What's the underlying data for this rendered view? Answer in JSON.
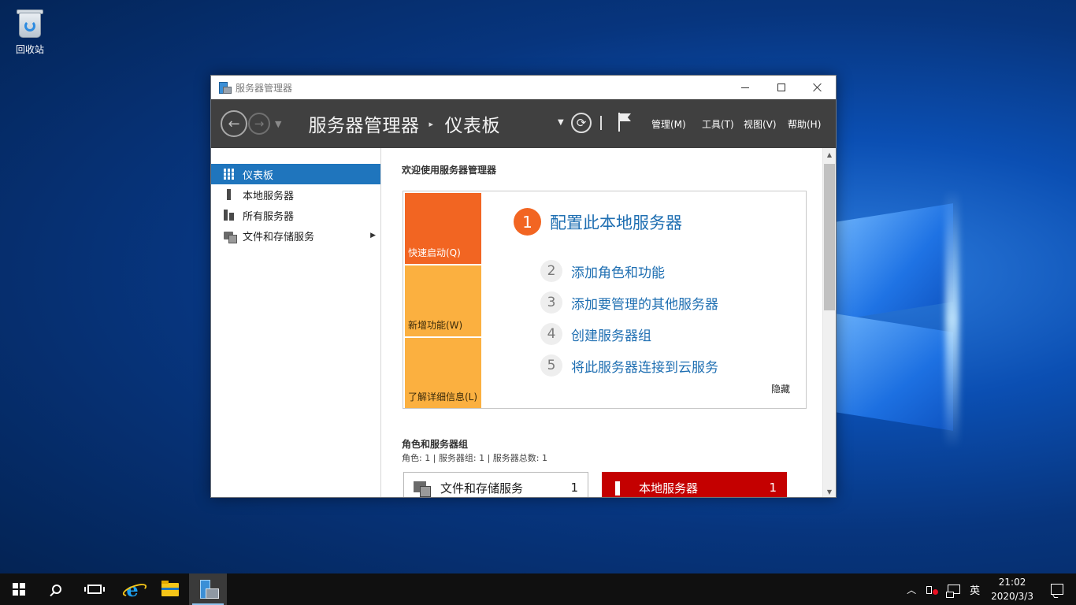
{
  "desktop": {
    "icons": [
      {
        "label": "回收站",
        "icon": "recycle-bin-icon"
      }
    ]
  },
  "window": {
    "titlebar": {
      "title": "服务器管理器"
    },
    "header": {
      "breadcrumb_root": "服务器管理器",
      "breadcrumb_separator": "▸",
      "breadcrumb_current": "仪表板",
      "menus": [
        "管理(M)",
        "工具(T)",
        "视图(V)",
        "帮助(H)"
      ]
    },
    "sidebar": {
      "items": [
        {
          "label": "仪表板",
          "active": true
        },
        {
          "label": "本地服务器",
          "active": false
        },
        {
          "label": "所有服务器",
          "active": false
        },
        {
          "label": "文件和存储服务",
          "active": false,
          "has_submenu": true
        }
      ]
    },
    "main": {
      "welcome_title": "欢迎使用服务器管理器",
      "tiles": [
        "快速启动(Q)",
        "新增功能(W)",
        "了解详细信息(L)"
      ],
      "steps": [
        {
          "num": "1",
          "label": "配置此本地服务器"
        },
        {
          "num": "2",
          "label": "添加角色和功能"
        },
        {
          "num": "3",
          "label": "添加要管理的其他服务器"
        },
        {
          "num": "4",
          "label": "创建服务器组"
        },
        {
          "num": "5",
          "label": "将此服务器连接到云服务"
        }
      ],
      "hide_link": "隐藏",
      "roles_title": "角色和服务器组",
      "roles_summary": "角色: 1 | 服务器组: 1 | 服务器总数: 1",
      "role_cards": [
        {
          "label": "文件和存储服务",
          "count": "1"
        },
        {
          "label": "本地服务器",
          "count": "1"
        }
      ]
    }
  },
  "taskbar": {
    "pinned": [
      "start",
      "search",
      "task-view",
      "internet-explorer",
      "file-explorer",
      "server-manager"
    ],
    "tray": {
      "chevron": "︿",
      "ime": "英",
      "time": "21:02",
      "date": "2020/3/3"
    }
  },
  "colors": {
    "accent_blue": "#1f75bd",
    "orange": "#f26522",
    "amber": "#fbb040",
    "alert_red": "#c40000",
    "header_dark": "#404040"
  }
}
